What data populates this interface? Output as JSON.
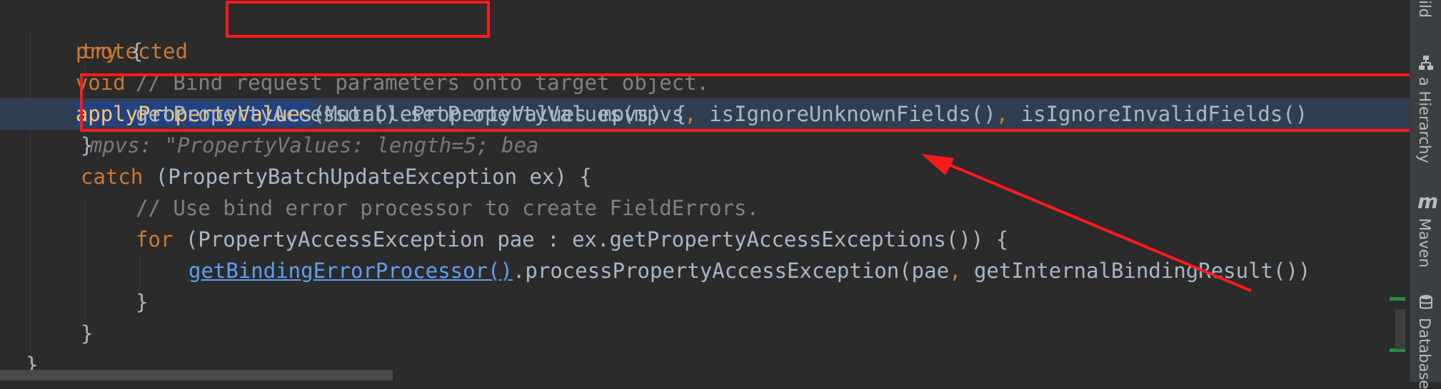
{
  "editor": {
    "lines": {
      "l1": {
        "kw_protected": "protected",
        "kw_void": "void",
        "method": "applyPropertyValues",
        "params": "(MutablePropertyValues mpvs) {",
        "hint": "mpvs: \"PropertyValues: length=5; bea"
      },
      "l2": {
        "kw_try": "try",
        "rest": " {"
      },
      "l3": {
        "comment": "// Bind request parameters onto target object."
      },
      "l4": {
        "p1": "getPropertyAccessor().setPropertyValues(mpvs",
        "c1": ",",
        "p2": " isIgnoreUnknownFields()",
        "c2": ",",
        "p3": " isIgnoreInvalidFields()"
      },
      "l5": {
        "text": "}"
      },
      "l6": {
        "kw_catch": "catch",
        "rest": " (PropertyBatchUpdateException ex) {"
      },
      "l7": {
        "comment": "// Use bind error processor to create FieldErrors."
      },
      "l8": {
        "kw_for": "for",
        "rest": " (PropertyAccessException pae : ex.getPropertyAccessExceptions()) {"
      },
      "l9": {
        "link": "getBindingErrorProcessor()",
        "p1": ".processPropertyAccessException(pae",
        "c1": ",",
        "p2": " getInternalBindingResult())"
      },
      "l10": {
        "text": "}"
      },
      "l11": {
        "text": "}"
      },
      "l12": {
        "text": "}"
      }
    }
  },
  "right_panel": {
    "top_label": "ild",
    "hierarchy_label": "a Hierarchy",
    "maven_label": "Maven",
    "maven_icon_glyph": "m",
    "database_label": "Database"
  },
  "colors": {
    "background": "#2b2b2b",
    "keyword": "#cc7832",
    "method": "#ffc66d",
    "comment": "#808080",
    "annotation_red": "#ff1a1a",
    "selection": "#214283",
    "current_line": "#2f3e52"
  }
}
